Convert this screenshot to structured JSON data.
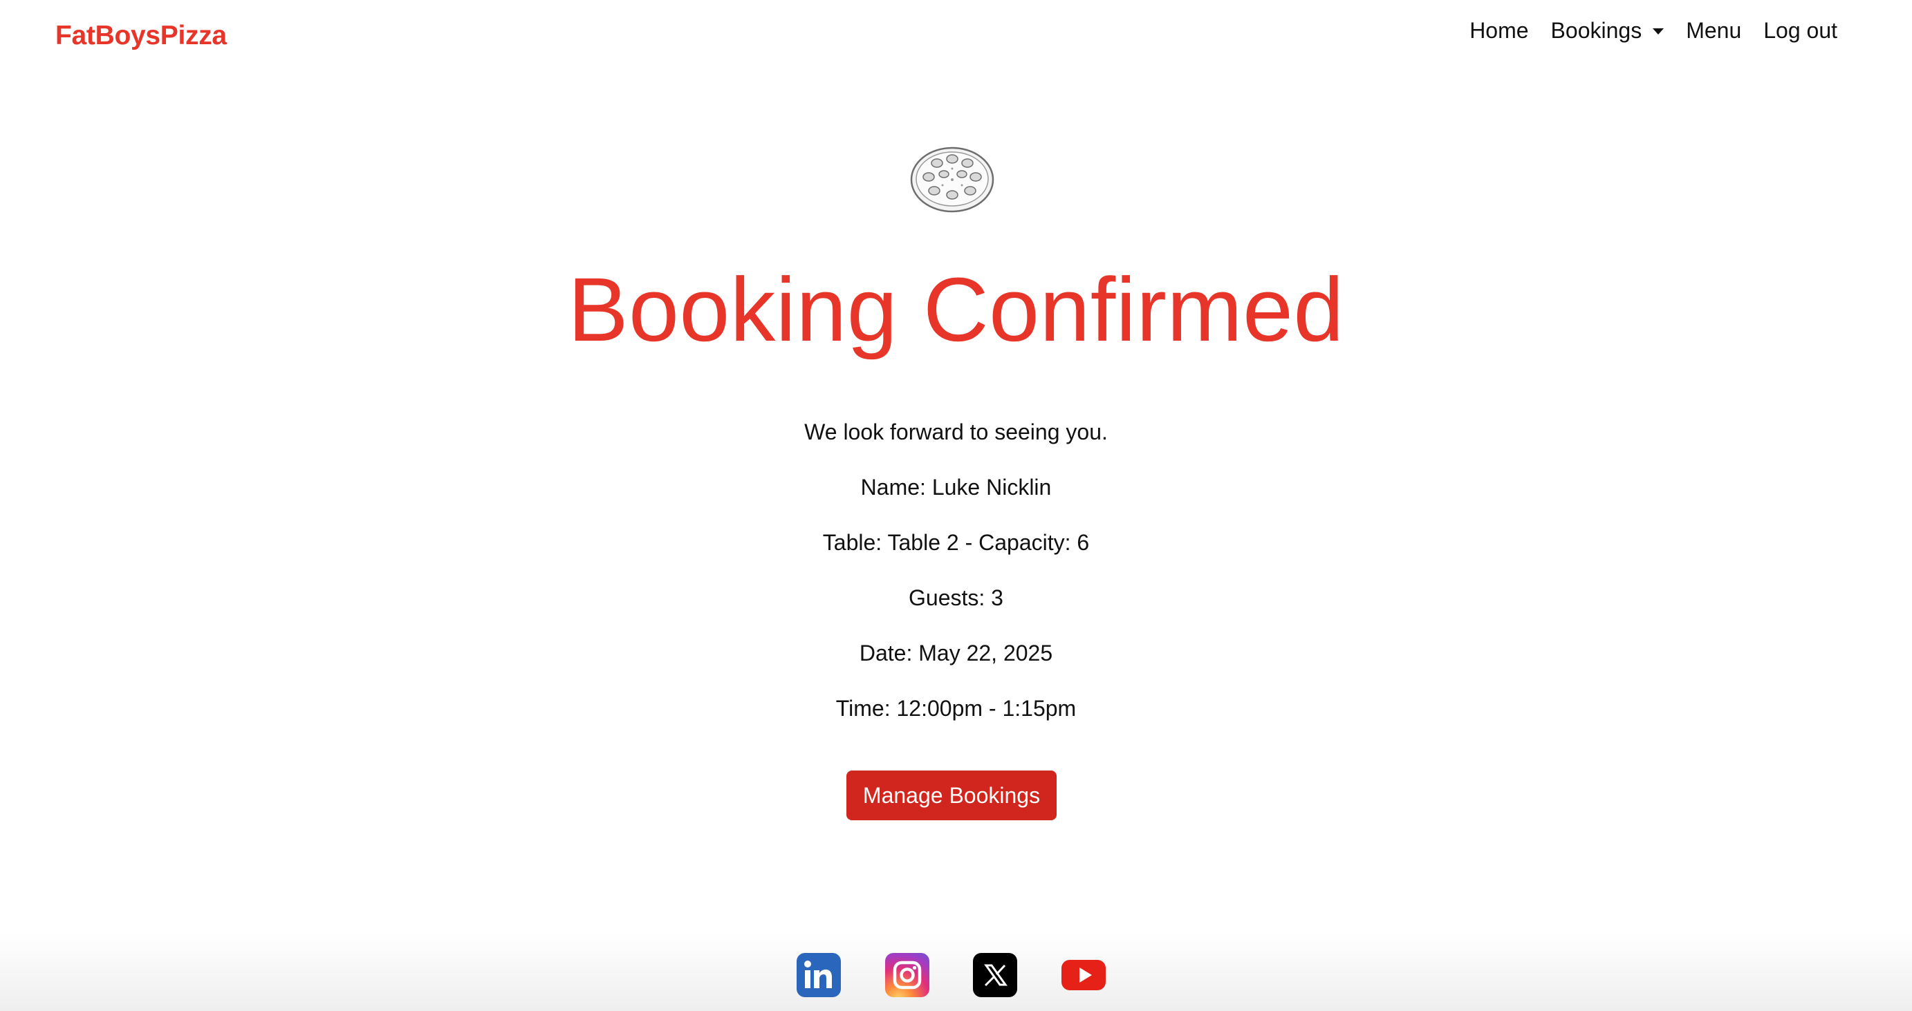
{
  "navbar": {
    "brand": "FatBoysPizza",
    "links": {
      "home": "Home",
      "bookings": "Bookings",
      "menu": "Menu",
      "logout": "Log out"
    }
  },
  "main": {
    "title": "Booking Confirmed",
    "message": "We look forward to seeing you.",
    "details": {
      "name": "Name: Luke Nicklin",
      "table": "Table: Table 2 - Capacity: 6",
      "guests": "Guests: 3",
      "date": "Date: May 22, 2025",
      "time": "Time: 12:00pm - 1:15pm"
    },
    "manage_button": "Manage Bookings"
  },
  "colors": {
    "accent": "#e8352a",
    "button": "#d1261e"
  },
  "icons": {
    "hero": "pizza-icon",
    "social": [
      "linkedin-icon",
      "instagram-icon",
      "x-icon",
      "youtube-icon"
    ]
  }
}
